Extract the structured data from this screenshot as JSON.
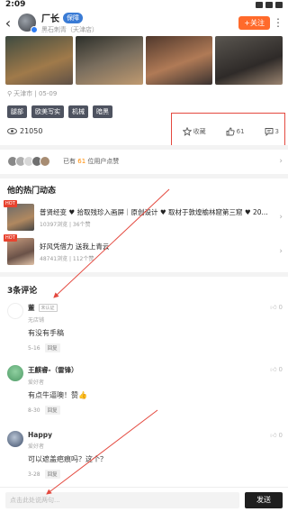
{
  "status": {
    "time": "2:09"
  },
  "header": {
    "back_icon": "back-arrow-icon",
    "author_name": "厂长",
    "author_tag": "保障",
    "author_sub": "黑石刺青（天津店）",
    "follow_label": "+关注",
    "more_icon": "more-dots-icon"
  },
  "post": {
    "location": "天津市 | 05-09",
    "tags": [
      "腿部",
      "欧美写实",
      "机械",
      "暗黑"
    ],
    "views": "21050",
    "actions": {
      "collect_label": "收藏",
      "like_count": "61",
      "comment_count": "3"
    }
  },
  "likers": {
    "prefix": "已有",
    "count": "61",
    "suffix": "位用户点赞"
  },
  "hot_section": {
    "title": "他的热门动态",
    "posts": [
      {
        "hot": "HOT",
        "title": "普贤经变 ♥ 拾取残珍入画屏｜原创设计 ♥ 取材于敦煌榆林窟第三窟 ♥ 20...",
        "meta": "10397浏览 | 36个赞"
      },
      {
        "hot": "HOT",
        "title": "好风凭借力 送我上青云",
        "meta": "48741浏览 | 112个赞"
      }
    ]
  },
  "comments_section": {
    "title": "3条评论",
    "comments": [
      {
        "name": "董",
        "badge": "未认证",
        "role": "无店铺",
        "text": "有没有手稿",
        "date": "5-16",
        "reply": "回复",
        "likes": "0"
      },
      {
        "name": "王麒睿-（雷锋）",
        "badge": "",
        "role": "爱好者",
        "text": "有点牛逼噢！赞👍",
        "date": "8-30",
        "reply": "回复",
        "likes": "0"
      },
      {
        "name": "Happy",
        "badge": "",
        "role": "爱好者",
        "text": "可以遮盖疤痕吗？这个？",
        "date": "3-28",
        "reply": "回复",
        "likes": "0"
      }
    ]
  },
  "input_bar": {
    "placeholder": "点击此处说两句...",
    "send_label": "发送"
  },
  "colors": {
    "accent": "#ff6a2b",
    "annotation": "#e4493f",
    "highlight": "#ff8a00"
  }
}
